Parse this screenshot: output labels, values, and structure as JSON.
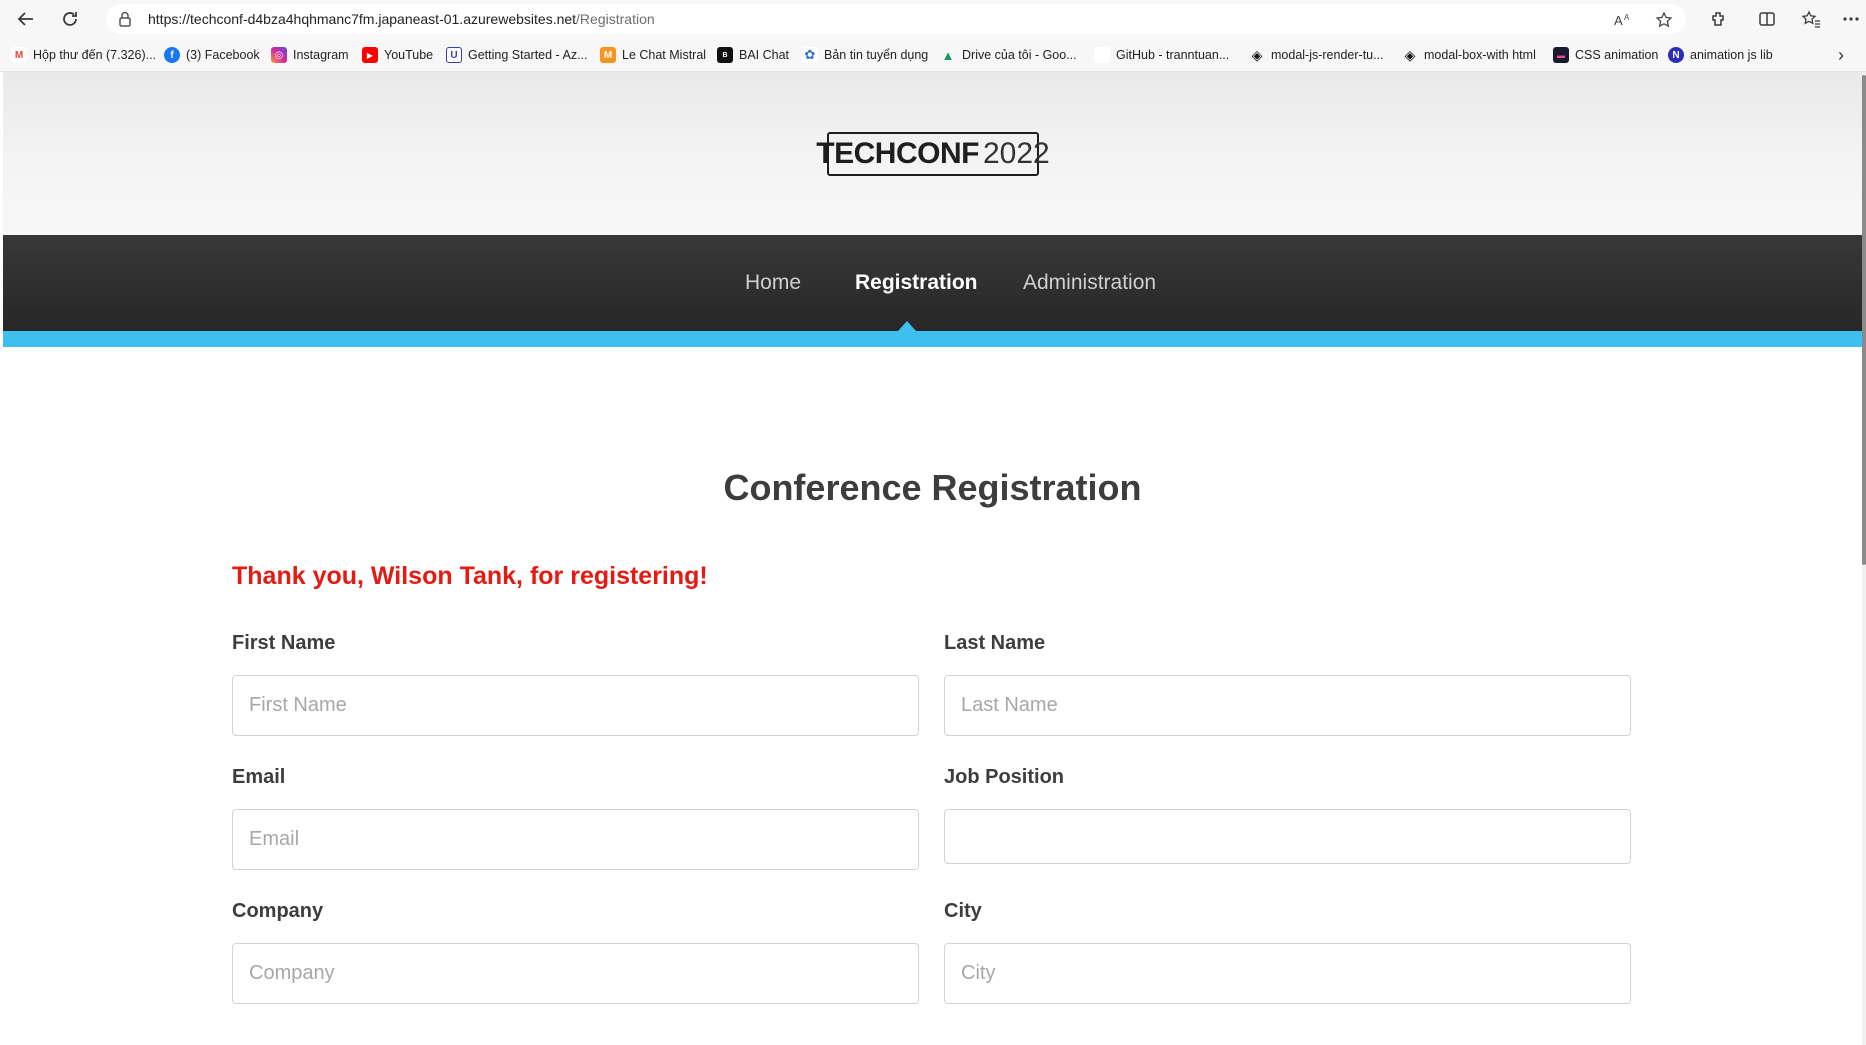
{
  "browser": {
    "url_host": "https://techconf-d4bza4hqhmanc7fm.japaneast-01.azurewebsites.net",
    "url_path": "/Registration",
    "bookmarks": [
      {
        "label": "Hộp thư đến (7.326)...",
        "icon": "gmail-icon",
        "color": "#ea4335",
        "glyph": "M"
      },
      {
        "label": "(3) Facebook",
        "icon": "facebook-icon",
        "color": "#1877f2",
        "glyph": "f"
      },
      {
        "label": "Instagram",
        "icon": "instagram-icon",
        "color": "#d6249f",
        "glyph": "◎"
      },
      {
        "label": "YouTube",
        "icon": "youtube-icon",
        "color": "#ff0000",
        "glyph": "▶"
      },
      {
        "label": "Getting Started - Az...",
        "icon": "azure-icon",
        "color": "#3b3bb3",
        "glyph": "U"
      },
      {
        "label": "Le Chat Mistral",
        "icon": "mistral-icon",
        "color": "#f7931e",
        "glyph": "M"
      },
      {
        "label": "BAI Chat",
        "icon": "baichat-icon",
        "color": "#111111",
        "glyph": "B"
      },
      {
        "label": "Bản tin tuyển dụng",
        "icon": "people-icon",
        "color": "#2f6fd1",
        "glyph": "✿"
      },
      {
        "label": "Drive của tôi - Goo...",
        "icon": "google-drive-icon",
        "color": "#0f9d58",
        "glyph": "▲"
      },
      {
        "label": "GitHub - tranntuan...",
        "icon": "github-icon",
        "color": "#ffffff",
        "glyph": ""
      },
      {
        "label": "modal-js-render-tu...",
        "icon": "codepen-icon",
        "color": "#111111",
        "glyph": "◈"
      },
      {
        "label": "modal-box-with html",
        "icon": "codepen-icon",
        "color": "#111111",
        "glyph": "◈"
      },
      {
        "label": "CSS animation",
        "icon": "css-animation-icon",
        "color": "#1a1a2e",
        "glyph": "▬"
      },
      {
        "label": "animation js lib",
        "icon": "notion-icon",
        "color": "#2d2dbd",
        "glyph": "N"
      }
    ]
  },
  "site": {
    "logo_bold": "TECHCONF",
    "logo_year": "2022",
    "nav": {
      "home": "Home",
      "registration": "Registration",
      "administration": "Administration"
    }
  },
  "registration": {
    "title": "Conference Registration",
    "thank_you": "Thank you, Wilson Tank, for registering!",
    "fields": {
      "first_name": {
        "label": "First Name",
        "placeholder": "First Name",
        "value": ""
      },
      "last_name": {
        "label": "Last Name",
        "placeholder": "Last Name",
        "value": ""
      },
      "email": {
        "label": "Email",
        "placeholder": "Email",
        "value": ""
      },
      "job_position": {
        "label": "Job Position",
        "placeholder": "",
        "value": ""
      },
      "company": {
        "label": "Company",
        "placeholder": "Company",
        "value": ""
      },
      "city": {
        "label": "City",
        "placeholder": "City",
        "value": ""
      }
    }
  },
  "colors": {
    "accent_blue": "#3fbef0",
    "nav_background": "#2e2e2e",
    "thank_you_red": "#e31b13"
  }
}
